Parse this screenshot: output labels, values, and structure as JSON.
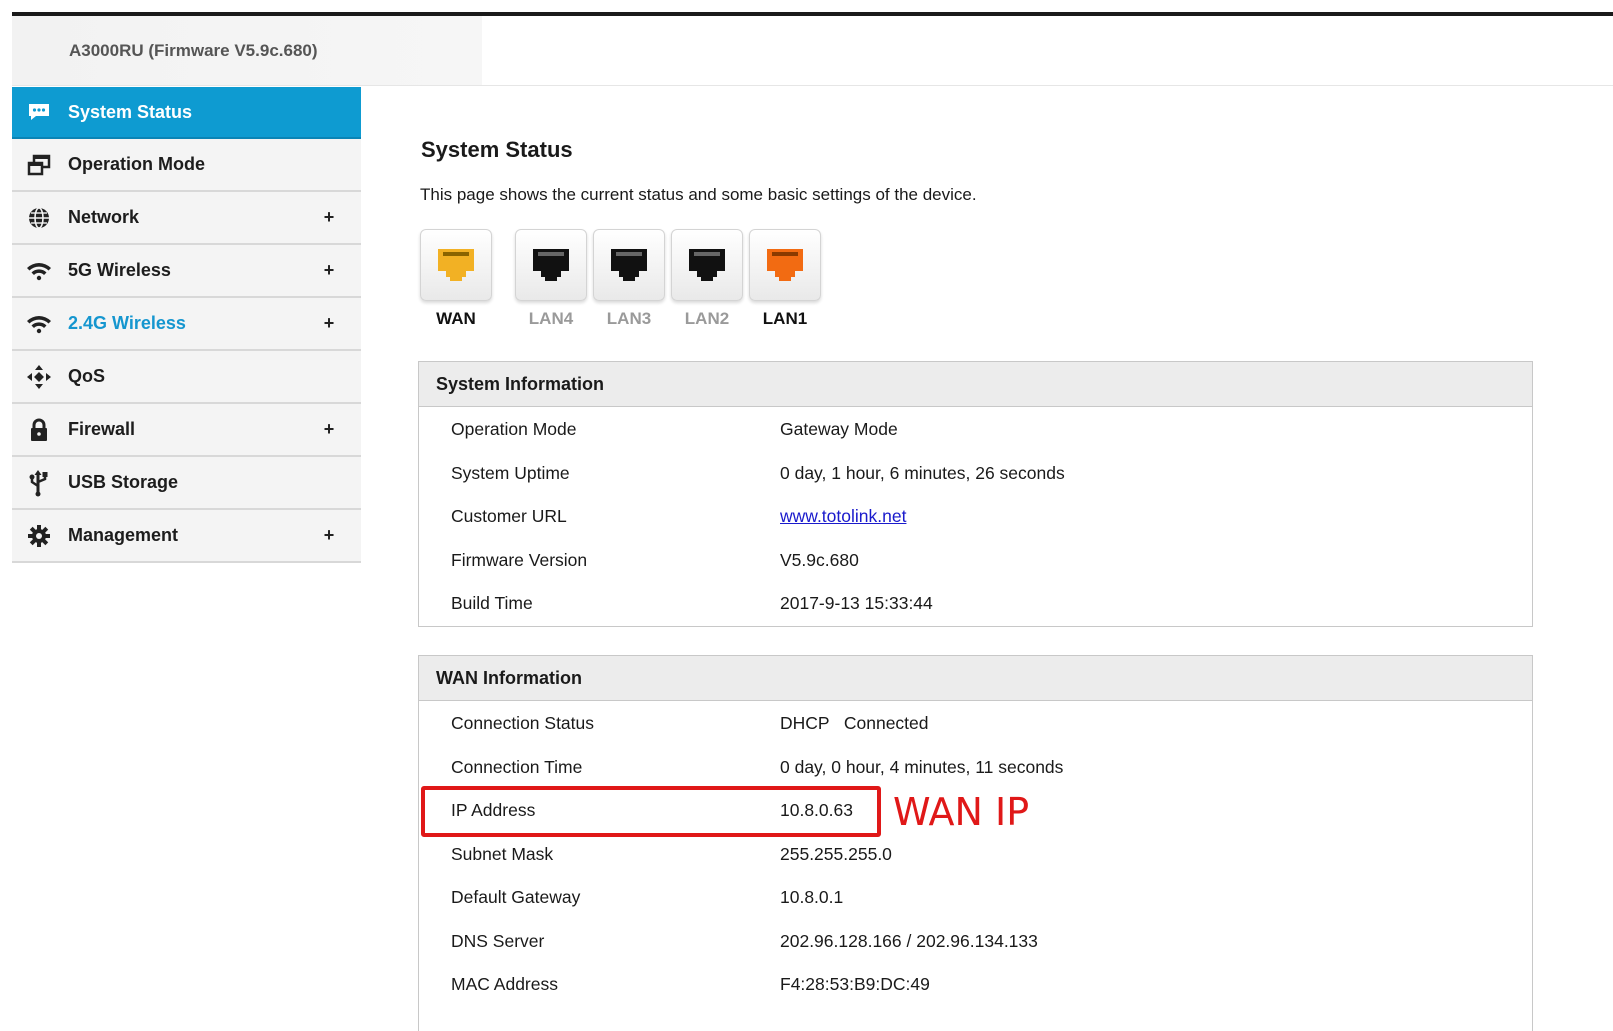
{
  "header": {
    "title": "A3000RU (Firmware V5.9c.680)"
  },
  "sidebar": {
    "items": [
      {
        "label": "System Status",
        "icon": "chat-icon",
        "expandable": false,
        "state": "active"
      },
      {
        "label": "Operation Mode",
        "icon": "windows-icon",
        "expandable": false,
        "state": "normal"
      },
      {
        "label": "Network",
        "icon": "globe-icon",
        "expandable": true,
        "state": "normal"
      },
      {
        "label": "5G Wireless",
        "icon": "wifi-icon",
        "expandable": true,
        "state": "normal"
      },
      {
        "label": "2.4G Wireless",
        "icon": "wifi-icon",
        "expandable": true,
        "state": "hover"
      },
      {
        "label": "QoS",
        "icon": "qos-arrows-icon",
        "expandable": false,
        "state": "normal"
      },
      {
        "label": "Firewall",
        "icon": "lock-icon",
        "expandable": true,
        "state": "normal"
      },
      {
        "label": "USB Storage",
        "icon": "usb-icon",
        "expandable": false,
        "state": "normal"
      },
      {
        "label": "Management",
        "icon": "gear-icon",
        "expandable": true,
        "state": "normal"
      }
    ],
    "plus_symbol": "+"
  },
  "main": {
    "title": "System Status",
    "description": "This page shows the current status and some basic settings of the device.",
    "ports": [
      {
        "label": "WAN",
        "status": "connected",
        "color": "#f2b124"
      },
      {
        "label": "LAN4",
        "status": "disconnected",
        "color": "#111111"
      },
      {
        "label": "LAN3",
        "status": "disconnected",
        "color": "#111111"
      },
      {
        "label": "LAN2",
        "status": "disconnected",
        "color": "#111111"
      },
      {
        "label": "LAN1",
        "status": "connected",
        "color": "#f26b12"
      }
    ],
    "system_info": {
      "heading": "System Information",
      "rows": [
        {
          "key": "Operation Mode",
          "value": "Gateway Mode"
        },
        {
          "key": "System Uptime",
          "value": "0 day, 1 hour, 6 minutes, 26 seconds"
        },
        {
          "key": "Customer URL",
          "value": "www.totolink.net"
        },
        {
          "key": "Firmware Version",
          "value": "V5.9c.680"
        },
        {
          "key": "Build Time",
          "value": "2017-9-13 15:33:44"
        }
      ]
    },
    "wan_info": {
      "heading": "WAN Information",
      "rows": [
        {
          "key": "Connection Status",
          "value": "DHCP   Connected"
        },
        {
          "key": "Connection Time",
          "value": "0 day, 0 hour, 4 minutes, 11 seconds"
        },
        {
          "key": "IP Address",
          "value": "10.8.0.63"
        },
        {
          "key": "Subnet Mask",
          "value": "255.255.255.0"
        },
        {
          "key": "Default Gateway",
          "value": "10.8.0.1"
        },
        {
          "key": "DNS Server",
          "value": "202.96.128.166 / 202.96.134.133"
        },
        {
          "key": "MAC Address",
          "value": "F4:28:53:B9:DC:49"
        }
      ]
    }
  },
  "annotation": {
    "text": "WAN IP",
    "color": "#e01818"
  },
  "colors": {
    "accent": "#0e9bd1",
    "hover_text": "#1596cf",
    "link": "#1a1acc"
  }
}
